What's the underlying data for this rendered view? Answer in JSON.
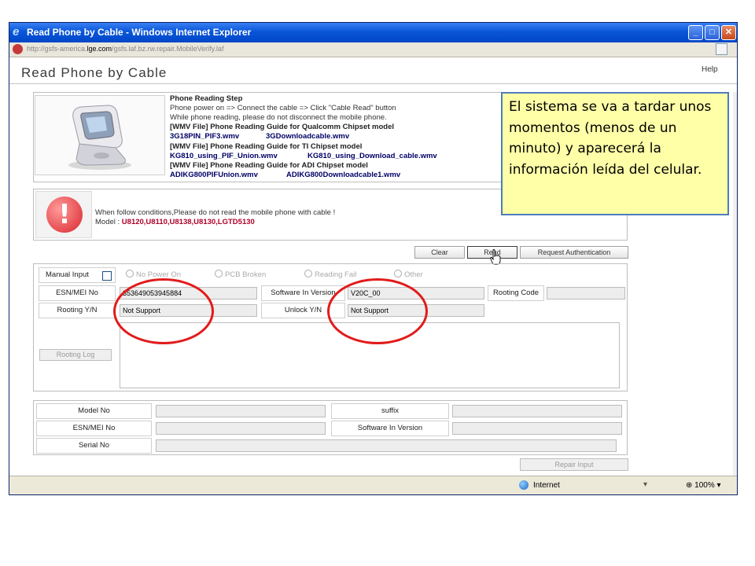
{
  "window": {
    "title": "Read Phone by Cable - Windows Internet Explorer",
    "url_prefix": "http://gsfs-america.",
    "url_domain": "lge.com",
    "url_path": "/gsfs.laf.bz.rw.repair.MobileVerify.laf",
    "title_icon": "ie-icon",
    "controls": {
      "minimize": "_",
      "maximize": "□",
      "close": "✕"
    }
  },
  "page": {
    "title": "Read Phone by Cable",
    "help": "Help"
  },
  "info": {
    "heading": "Phone Reading Step",
    "line1": "Phone power on => Connect the cable => Click \"Cable Read\" button",
    "line2": "While phone reading, please do not disconnect the mobile phone.",
    "guide_qualcomm": "[WMV File] Phone Reading Guide for Qualcomm Chipset model",
    "qualcomm_link1": "3G18PIN_PIF3.wmv",
    "qualcomm_link2": "3GDownloadcable.wmv",
    "guide_ti": "[WMV File] Phone Reading Guide for TI Chipset model",
    "ti_link1": "KG810_using_PIF_Union.wmv",
    "ti_link2": "KG810_using_Download_cable.wmv",
    "guide_adi": "[WMV File] Phone Reading Guide for ADI Chipset model",
    "adi_link1": "ADIKG800PIFUnion.wmv",
    "adi_link2": "ADIKG800Downloadcable1.wmv"
  },
  "warning": {
    "text": "When follow conditions,Please do not read the mobile phone with cable !",
    "model_label": "Model : ",
    "models": "U8120,U8110,U8138,U8130,LGTD5130"
  },
  "actions": {
    "clear": "Clear",
    "read": "Read",
    "request_auth": "Request Authentication"
  },
  "reading": {
    "manual_input": "Manual Input",
    "radio_no_power": "No Power On",
    "radio_pcb": "PCB Broken",
    "radio_reading_fail": "Reading Fail",
    "radio_other": "Other",
    "esn_label": "ESN/MEI No",
    "esn_value": "353649053945884",
    "sw_label": "Software In Version",
    "sw_value": "V20C_00",
    "rooting_code_label": "Rooting Code",
    "rooting_code_value": "",
    "rooting_yn_label": "Rooting Y/N",
    "rooting_yn_value": "Not Support",
    "unlock_label": "Unlock Y/N",
    "unlock_value": "Not Support",
    "rooting_log": "Rooting Log"
  },
  "result": {
    "model_no": "Model No",
    "suffix": "suffix",
    "esn": "ESN/MEI No",
    "sw": "Software In Version",
    "serial": "Serial No"
  },
  "repair_input": "Repair Input",
  "status": {
    "zone": "Internet",
    "zoom": "100%",
    "zoom_arrow": "▾"
  },
  "callout": "El sistema se va a tardar unos momentos (menos de un minuto) y aparecerá la información leída del celular.",
  "colors": {
    "titlebar": "#0a56d8",
    "callout_bg": "#ffffa8",
    "callout_border": "#4e7cba",
    "annotation": "#e21b1b",
    "models": "#b0002a"
  }
}
